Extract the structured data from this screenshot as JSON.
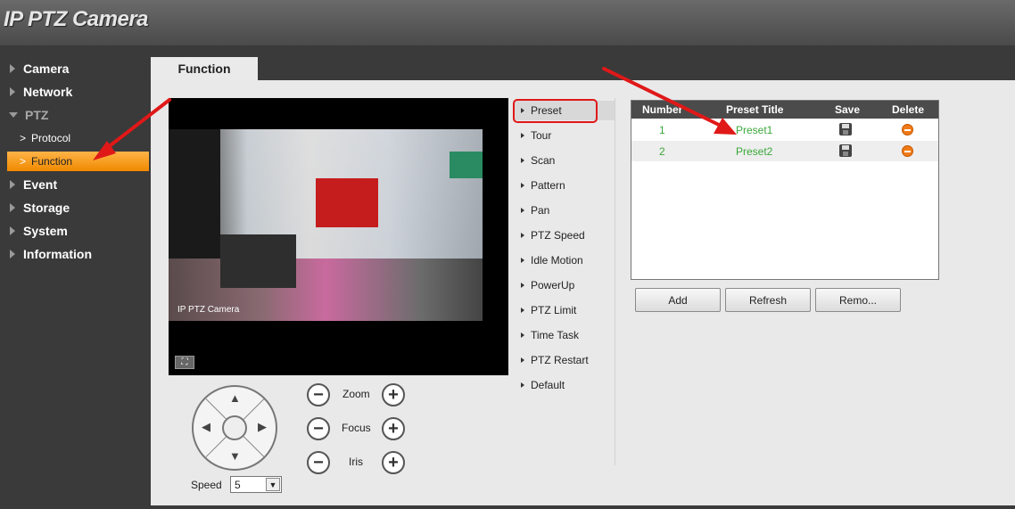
{
  "app": {
    "title": "IP PTZ Camera"
  },
  "sidebar": {
    "items": [
      {
        "label": "Camera"
      },
      {
        "label": "Network"
      },
      {
        "label": "PTZ"
      },
      {
        "label": "Event"
      },
      {
        "label": "Storage"
      },
      {
        "label": "System"
      },
      {
        "label": "Information"
      }
    ],
    "ptz_sub": [
      {
        "label": "Protocol"
      },
      {
        "label": "Function"
      }
    ]
  },
  "tab": {
    "label": "Function"
  },
  "video": {
    "watermark": "IP PTZ Camera"
  },
  "controls": {
    "zoom_label": "Zoom",
    "focus_label": "Focus",
    "iris_label": "Iris",
    "minus": "−",
    "plus": "+",
    "speed_label": "Speed",
    "speed_value": "5"
  },
  "function_menu": [
    {
      "label": "Preset"
    },
    {
      "label": "Tour"
    },
    {
      "label": "Scan"
    },
    {
      "label": "Pattern"
    },
    {
      "label": "Pan"
    },
    {
      "label": "PTZ Speed"
    },
    {
      "label": "Idle Motion"
    },
    {
      "label": "PowerUp"
    },
    {
      "label": "PTZ Limit"
    },
    {
      "label": "Time Task"
    },
    {
      "label": "PTZ Restart"
    },
    {
      "label": "Default"
    }
  ],
  "preset_table": {
    "headers": {
      "number": "Number",
      "title": "Preset Title",
      "save": "Save",
      "delete": "Delete"
    },
    "rows": [
      {
        "number": "1",
        "title": "Preset1"
      },
      {
        "number": "2",
        "title": "Preset2"
      }
    ]
  },
  "buttons": {
    "add": "Add",
    "refresh": "Refresh",
    "remove": "Remo..."
  },
  "colors": {
    "accent": "#f08a00",
    "annotation": "#e01818",
    "preset_text": "#3aa83a"
  }
}
